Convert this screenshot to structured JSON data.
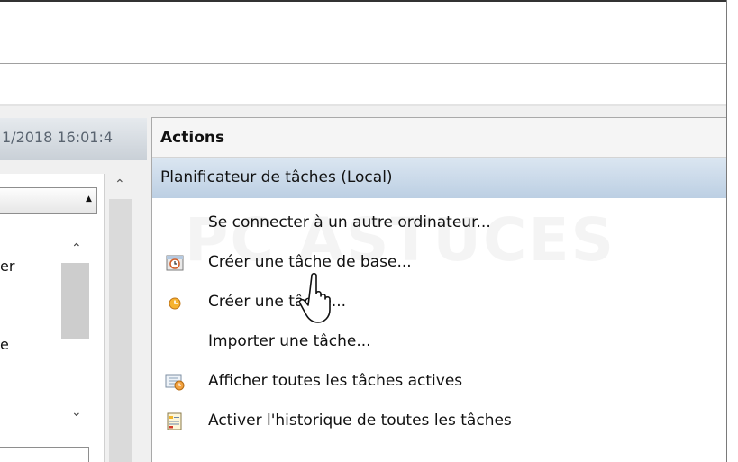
{
  "left": {
    "header_text": "1/2018 16:01:4",
    "rows": [
      "er",
      "e"
    ]
  },
  "actions": {
    "title": "Actions",
    "group": "Planificateur de tâches (Local)",
    "items": [
      {
        "label": "Se connecter à un autre ordinateur...",
        "icon": "none"
      },
      {
        "label": "Créer une tâche de base...",
        "icon": "basic-task-icon"
      },
      {
        "label": "Créer une tâche...",
        "icon": "task-icon"
      },
      {
        "label": "Importer une tâche...",
        "icon": "none"
      },
      {
        "label": "Afficher toutes les tâches actives",
        "icon": "active-tasks-icon"
      },
      {
        "label": "Activer l'historique de toutes les tâches",
        "icon": "history-icon"
      }
    ]
  },
  "watermark": "ASTUCES"
}
